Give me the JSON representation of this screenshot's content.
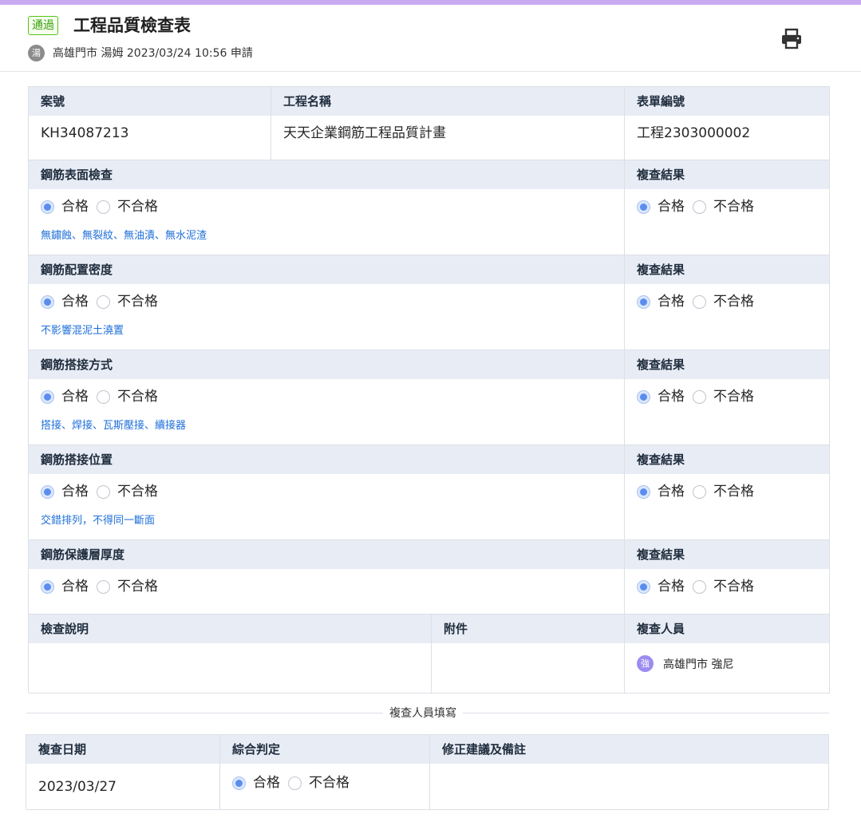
{
  "header": {
    "status_badge": "通過",
    "title": "工程品質檢查表",
    "applicant_avatar": "湯",
    "subtitle": "高雄門市 湯姆  2023/03/24 10:56  申請",
    "print_icon": "printer-icon"
  },
  "info": {
    "case_no_label": "案號",
    "case_no": "KH34087213",
    "project_label": "工程名稱",
    "project": "天天企業鋼筋工程品質計畫",
    "form_no_label": "表單編號",
    "form_no": "工程2303000002"
  },
  "radio": {
    "pass": "合格",
    "fail": "不合格"
  },
  "review_label": "複查結果",
  "checks": [
    {
      "label": "鋼筋表面檢查",
      "hint": "無鏽蝕、無裂紋、無油漬、無水泥渣",
      "result": "合格",
      "review": "合格"
    },
    {
      "label": "鋼筋配置密度",
      "hint": "不影響混泥土澆置",
      "result": "合格",
      "review": "合格"
    },
    {
      "label": "鋼筋搭接方式",
      "hint": "搭接、焊接、瓦斯壓接、續接器",
      "result": "合格",
      "review": "合格"
    },
    {
      "label": "鋼筋搭接位置",
      "hint": "交錯排列，不得同一斷面",
      "result": "合格",
      "review": "合格"
    },
    {
      "label": "鋼筋保護層厚度",
      "hint": "",
      "result": "合格",
      "review": "合格"
    }
  ],
  "footer_row": {
    "description_label": "檢查說明",
    "attachment_label": "附件",
    "reviewer_label": "複查人員",
    "reviewer_avatar": "強",
    "reviewer": "高雄門市 強尼"
  },
  "reviewer_section": {
    "divider": "複查人員填寫",
    "date_label": "複查日期",
    "date": "2023/03/27",
    "judgement_label": "綜合判定",
    "judgement": "合格",
    "remarks_label": "修正建議及備註"
  },
  "colors": {
    "accent_bar": "#c9a9f0",
    "header_bg": "#e8ecf5",
    "hint_text": "#1e6fd9",
    "radio_checked": "#5b8def",
    "badge_green": "#389e0d"
  }
}
